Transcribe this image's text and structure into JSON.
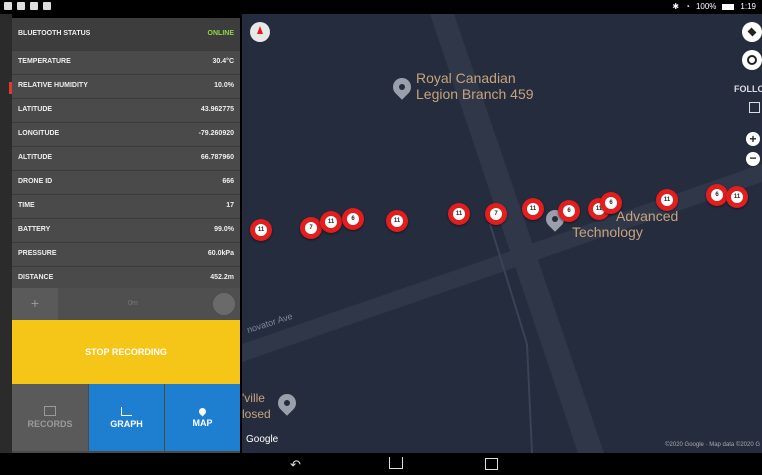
{
  "status_bar": {
    "battery": "100%",
    "time": "1:19"
  },
  "panel": {
    "bluetooth_label": "BLUETOOTH STATUS",
    "bluetooth_value": "ONLINE",
    "readings": [
      {
        "label": "TEMPERATURE",
        "value": "30.4°C"
      },
      {
        "label": "RELATIVE HUMIDITY",
        "value": "10.0%"
      },
      {
        "label": "LATITUDE",
        "value": "43.962775"
      },
      {
        "label": "LONGITUDE",
        "value": "-79.260920"
      },
      {
        "label": "ALTITUDE",
        "value": "66.787960"
      },
      {
        "label": "DRONE ID",
        "value": "666"
      },
      {
        "label": "TIME",
        "value": "17"
      },
      {
        "label": "BATTERY",
        "value": "99.0%"
      },
      {
        "label": "PRESSURE",
        "value": "60.0kPa"
      },
      {
        "label": "DISTANCE",
        "value": "452.2m"
      }
    ],
    "control_plus": "+",
    "control_mid": "0m",
    "stop_label": "STOP RECORDING"
  },
  "tabs": {
    "records": "RECORDS",
    "graph": "GRAPH",
    "map": "MAP"
  },
  "map": {
    "place_1_line1": "Royal Canadian",
    "place_1_line2": "Legion Branch 459",
    "place_2_line1": "Advanced",
    "place_2_line2": "Technology",
    "place_3_line1": "'ville",
    "place_3_line2": "losed",
    "road_label": "novator Ave",
    "follow_label": "FOLLO",
    "google": "Google",
    "attribution": "©2020 Google · Map data ©2020 G",
    "markers": [
      "11",
      "7",
      "11",
      "6",
      "11",
      "11",
      "7",
      "11",
      "6",
      "11",
      "6",
      "11",
      "6",
      "11"
    ]
  },
  "colors": {
    "accent_yellow": "#f5c518",
    "tab_blue": "#1e7fd0",
    "marker_red": "#e21e1e",
    "online_green": "#8fd34b"
  }
}
